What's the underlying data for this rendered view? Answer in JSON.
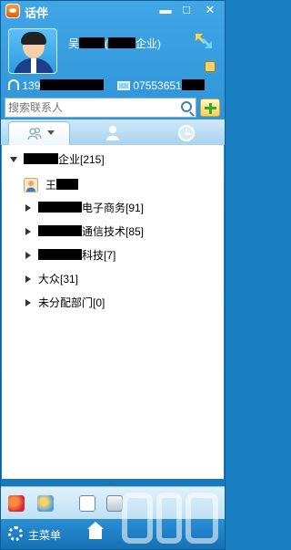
{
  "window": {
    "title": "话伴"
  },
  "window_controls": {
    "minimize": "▬",
    "maximize": "□",
    "close": "✕"
  },
  "profile": {
    "name_prefix": "吴",
    "name_mid": "(",
    "company_suffix": "企业)",
    "mobile_prefix": "139",
    "office_prefix": "07553651"
  },
  "search": {
    "placeholder": "搜索联系人"
  },
  "tree": {
    "root": {
      "suffix": "企业[215]"
    },
    "member": {
      "name": "王"
    },
    "groups": [
      {
        "suffix": "电子商务[91]"
      },
      {
        "suffix": "通信技术[85]"
      },
      {
        "suffix": "科技[7]"
      },
      {
        "label": "大众[31]"
      },
      {
        "label": "未分配部门[0]"
      }
    ]
  },
  "bottom": {
    "main_menu": "主菜单"
  },
  "colors": {
    "accent": "#1f86cc",
    "titlebar": "#41a6e6",
    "panel": "#ffffff"
  }
}
